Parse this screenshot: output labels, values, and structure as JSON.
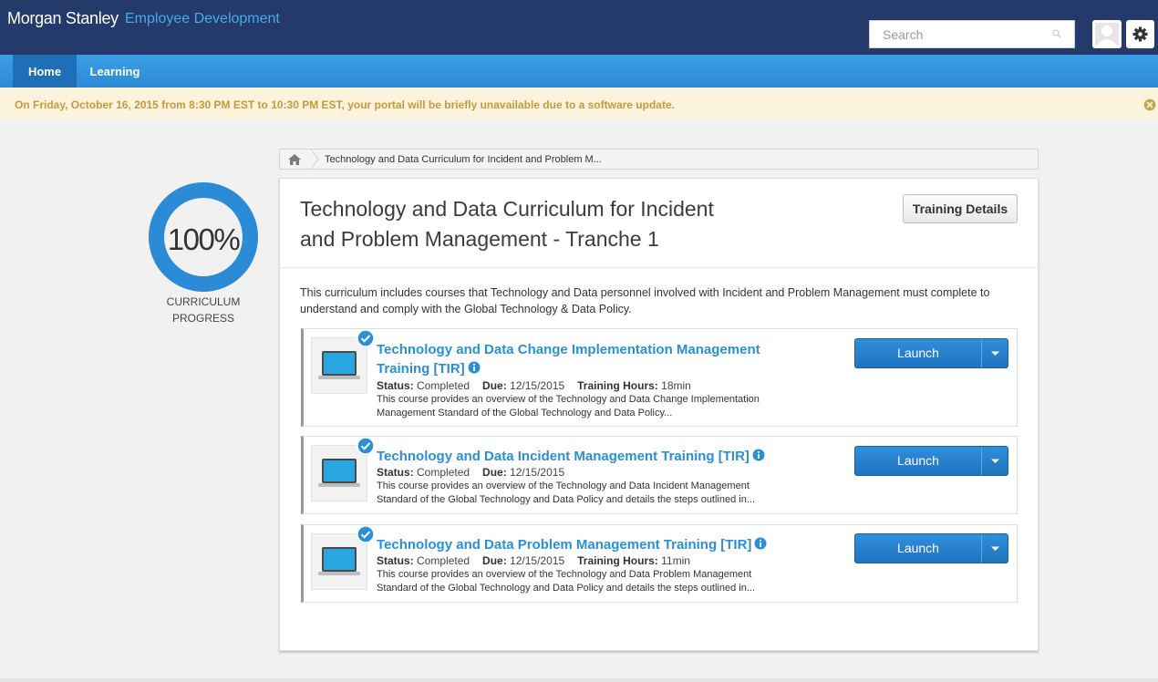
{
  "header": {
    "brand_name": "Morgan Stanley",
    "brand_sub": "Employee Development",
    "search_placeholder": "Search"
  },
  "nav": {
    "items": [
      {
        "label": "Home",
        "active": true
      },
      {
        "label": "Learning",
        "active": false
      }
    ]
  },
  "banner": {
    "text": "On Friday, October 16, 2015 from 8:30 PM EST to 10:30 PM EST, your portal will be briefly unavailable due to a software update."
  },
  "progress": {
    "percent_label": "100%",
    "percent_value": 100,
    "label_line1": "CURRICULUM",
    "label_line2": "PROGRESS"
  },
  "breadcrumb": {
    "current": "Technology and Data Curriculum for Incident and Problem M..."
  },
  "curriculum": {
    "title_line1": "Technology and Data Curriculum for Incident",
    "title_line2": "and Problem Management - Tranche 1",
    "details_button": "Training Details",
    "description": "This curriculum includes courses that Technology and Data personnel involved with Incident and Problem Management must complete to understand and comply with the Global Technology & Data Policy."
  },
  "courses": [
    {
      "title_line1": "Technology and Data Change Implementation Management",
      "title_line2": "Training [TIR]",
      "status_label": "Status:",
      "status": "Completed",
      "due_label": "Due:",
      "due": "12/15/2015",
      "hours_label": "Training Hours:",
      "hours": "18min",
      "desc_line1": "This course provides an overview of the Technology and Data Change Implementation",
      "desc_line2": "Management Standard of the Global Technology and Data Policy...",
      "launch": "Launch"
    },
    {
      "title_line1": "Technology and Data Incident Management Training [TIR]",
      "status_label": "Status:",
      "status": "Completed",
      "due_label": "Due:",
      "due": "12/15/2015",
      "desc_line1": "This course provides an overview of the Technology and Data Incident Management",
      "desc_line2": "Standard of the Global Technology and Data Policy and details the steps outlined in...",
      "launch": "Launch"
    },
    {
      "title_line1": "Technology and Data Problem Management Training [TIR]",
      "status_label": "Status:",
      "status": "Completed",
      "due_label": "Due:",
      "due": "12/15/2015",
      "hours_label": "Training Hours:",
      "hours": "11min",
      "desc_line1": "This course provides an overview of the Technology and Data Problem Management",
      "desc_line2": "Standard of the Global Technology and Data Policy and details the steps outlined in...",
      "launch": "Launch"
    }
  ],
  "colors": {
    "header_bg": "#233a6a",
    "nav_bg": "#2b8bd6",
    "accent_blue": "#2b8fd6",
    "banner_bg": "#fbf3dc",
    "banner_text": "#c39a3e"
  }
}
